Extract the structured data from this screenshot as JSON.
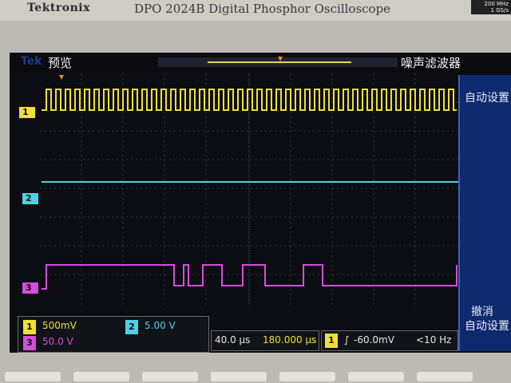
{
  "header": {
    "brand": "Tektronix",
    "model": "DPO 2024B Digital Phosphor Oscilloscope",
    "spec_top": "200 MHz",
    "spec_bottom": "1 GS/s"
  },
  "screen": {
    "logo": "Tek",
    "mode": "预览",
    "noise_filter": "噪声滤波器"
  },
  "side_menu": {
    "autoset": "自动设置",
    "cancel": "撤消",
    "cancel_autoset": "自动设置"
  },
  "channels": [
    {
      "id": "1",
      "color": "#f1e032",
      "scale": "500mV"
    },
    {
      "id": "2",
      "color": "#4fd0e6",
      "scale": "5.00 V"
    },
    {
      "id": "3",
      "color": "#d44dde",
      "scale": "50.0 V"
    }
  ],
  "timebase": {
    "per_div": "40.0 μs",
    "position": "180.000 μs"
  },
  "trigger": {
    "source": "1",
    "level": "-60.0mV",
    "freq": "<10 Hz"
  },
  "colors": {
    "screen_bg": "#0c0d12",
    "menu_bg": "#0d2a6e",
    "ch1": "#f1e032",
    "ch2": "#4fd0e6",
    "ch3": "#d44dde"
  }
}
